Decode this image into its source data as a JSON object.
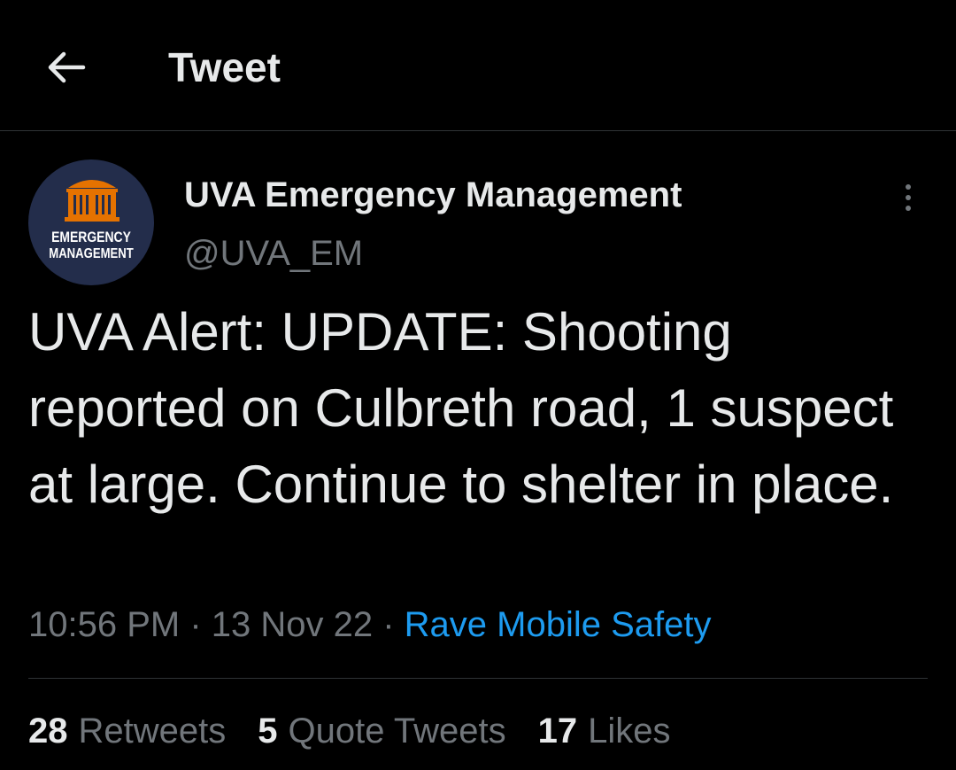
{
  "header": {
    "back_icon": "arrow-left-icon",
    "title": "Tweet"
  },
  "tweet": {
    "avatar": {
      "line1": "EMERGENCY",
      "line2": "MANAGEMENT",
      "background": "#232d4b",
      "seal_color": "#e57200",
      "icon": "rotunda-icon"
    },
    "author_name": "UVA Emergency Management",
    "handle": "@UVA_EM",
    "more_icon": "more-vertical-icon",
    "text": "UVA Alert: UPDATE: Shooting reported on Culbreth road, 1 suspect at large. Continue to shelter in place.",
    "time": "10:56 PM",
    "date": "13 Nov 22",
    "separator": " · ",
    "source": "Rave Mobile Safety"
  },
  "stats": [
    {
      "count": "28",
      "label": "Retweets"
    },
    {
      "count": "5",
      "label": "Quote Tweets"
    },
    {
      "count": "17",
      "label": "Likes"
    }
  ],
  "colors": {
    "background": "#000000",
    "primary_text": "#e7e9ea",
    "secondary_text": "#71767b",
    "link": "#1d9bf0",
    "divider": "#2f3336"
  }
}
